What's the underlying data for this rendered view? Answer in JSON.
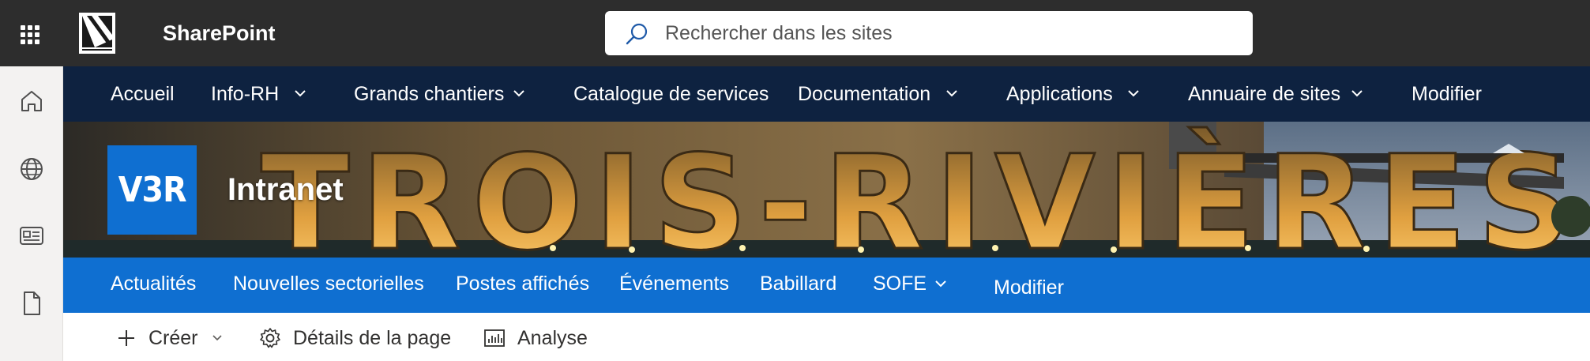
{
  "suite_bar": {
    "app_name": "SharePoint",
    "background": "#2d2d2d",
    "search": {
      "placeholder": "Rechercher dans les sites",
      "value": ""
    }
  },
  "app_bar": {
    "items": [
      {
        "icon": "home-icon"
      },
      {
        "icon": "globe-icon"
      },
      {
        "icon": "news-icon"
      },
      {
        "icon": "document-icon"
      }
    ]
  },
  "hub_nav": {
    "background": "#0e2240",
    "items": [
      {
        "label": "Accueil",
        "dropdown": false
      },
      {
        "label": "Info-RH",
        "dropdown": true
      },
      {
        "label": "Grands chantiers",
        "dropdown": true
      },
      {
        "label": "Catalogue de services",
        "dropdown": false
      },
      {
        "label": "Documentation",
        "dropdown": true
      },
      {
        "label": "Applications",
        "dropdown": true
      },
      {
        "label": "Annuaire de sites",
        "dropdown": true
      },
      {
        "label": "Modifier",
        "dropdown": false
      }
    ]
  },
  "banner": {
    "logo_text": "V3R",
    "site_title": "Intranet",
    "sign_text": "TROIS-RIVIÈRES",
    "logo_color": "#0f6fd1"
  },
  "site_nav": {
    "background": "#0f6fd1",
    "items": [
      {
        "label": "Actualités",
        "dropdown": false
      },
      {
        "label": "Nouvelles sectorielles",
        "dropdown": false
      },
      {
        "label": "Postes affichés",
        "dropdown": false
      },
      {
        "label": "Événements",
        "dropdown": false
      },
      {
        "label": "Babillard",
        "dropdown": false
      },
      {
        "label": "SOFE",
        "dropdown": true
      },
      {
        "label": "Modifier",
        "dropdown": false
      }
    ]
  },
  "command_bar": {
    "create": "Créer",
    "page_details": "Détails de la page",
    "analytics": "Analyse"
  }
}
